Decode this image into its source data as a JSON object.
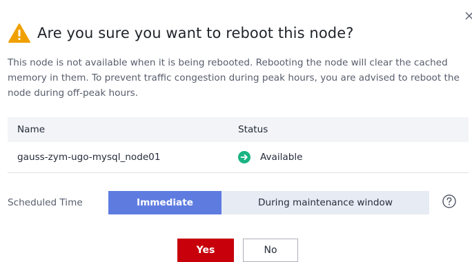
{
  "dialog": {
    "title": "Are you sure you want to reboot this node?",
    "description": "This node is not available when it is being rebooted. Rebooting the node will clear the cached memory in them. To prevent traffic congestion during peak hours, you are advised to reboot the node during off-peak hours.",
    "close_icon": "close-icon",
    "warning_icon": "warning-triangle-icon",
    "colors": {
      "warning": "#f0a000",
      "primary_danger": "#c7000b",
      "segment_active": "#5e7ce0",
      "status_available": "#19b482"
    }
  },
  "table": {
    "headers": {
      "name": "Name",
      "status": "Status"
    },
    "rows": [
      {
        "name": "gauss-zym-ugo-mysql_node01",
        "status": "Available",
        "status_icon": "arrow-right-circle-icon"
      }
    ]
  },
  "schedule": {
    "label": "Scheduled Time",
    "options": [
      {
        "label": "Immediate",
        "selected": true
      },
      {
        "label": "During maintenance window",
        "selected": false
      }
    ],
    "help_icon": "question-circle-icon"
  },
  "actions": {
    "yes_label": "Yes",
    "no_label": "No"
  }
}
